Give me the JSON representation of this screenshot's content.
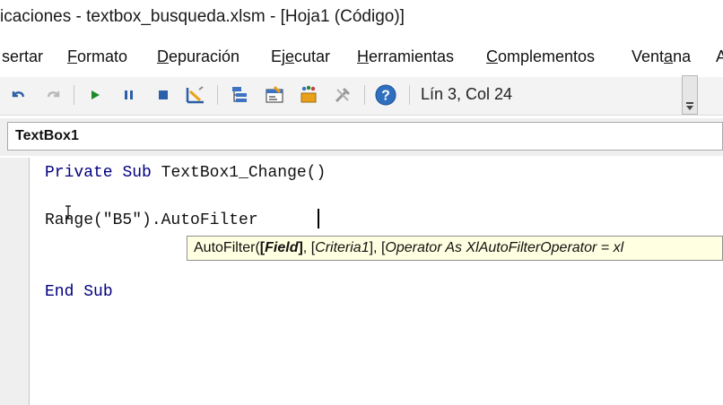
{
  "window": {
    "title": "icaciones - textbox_busqueda.xlsm - [Hoja1 (Código)]"
  },
  "menu": {
    "items": [
      {
        "label": "sertar"
      },
      {
        "label": "Formato"
      },
      {
        "label": "Depuración"
      },
      {
        "label": "Ejecutar"
      },
      {
        "label": "Herramientas"
      },
      {
        "label": "Complementos"
      },
      {
        "label": "Ventana"
      },
      {
        "label": "A"
      }
    ]
  },
  "toolbar": {
    "icons": [
      "undo-icon",
      "redo-icon",
      "run-icon",
      "pause-icon",
      "stop-icon",
      "design-mode-icon",
      "project-explorer-icon",
      "properties-icon",
      "object-browser-icon",
      "toolbox-icon",
      "help-icon"
    ],
    "position": "Lín 3, Col 24"
  },
  "object_selector": {
    "value": "TextBox1"
  },
  "code": {
    "line1_kw1": "Private",
    "line1_kw2": "Sub",
    "line1_rest": "TextBox1_Change()",
    "line2": "Range(\"B5\").AutoFilter ",
    "line3_kw1": "End",
    "line3_kw2": "Sub"
  },
  "intellisense": {
    "prefix": "AutoFilter(",
    "p1_open": "[",
    "p1": "Field",
    "p1_close": "]",
    "sep1": ", [",
    "p2": "Criteria1",
    "sep2": "], [",
    "p3": "Operator As XlAutoFilterOperator = xl"
  },
  "colors": {
    "keyword": "#00007f",
    "tooltip_bg": "#ffffe1",
    "help": "#2f6fc0"
  }
}
